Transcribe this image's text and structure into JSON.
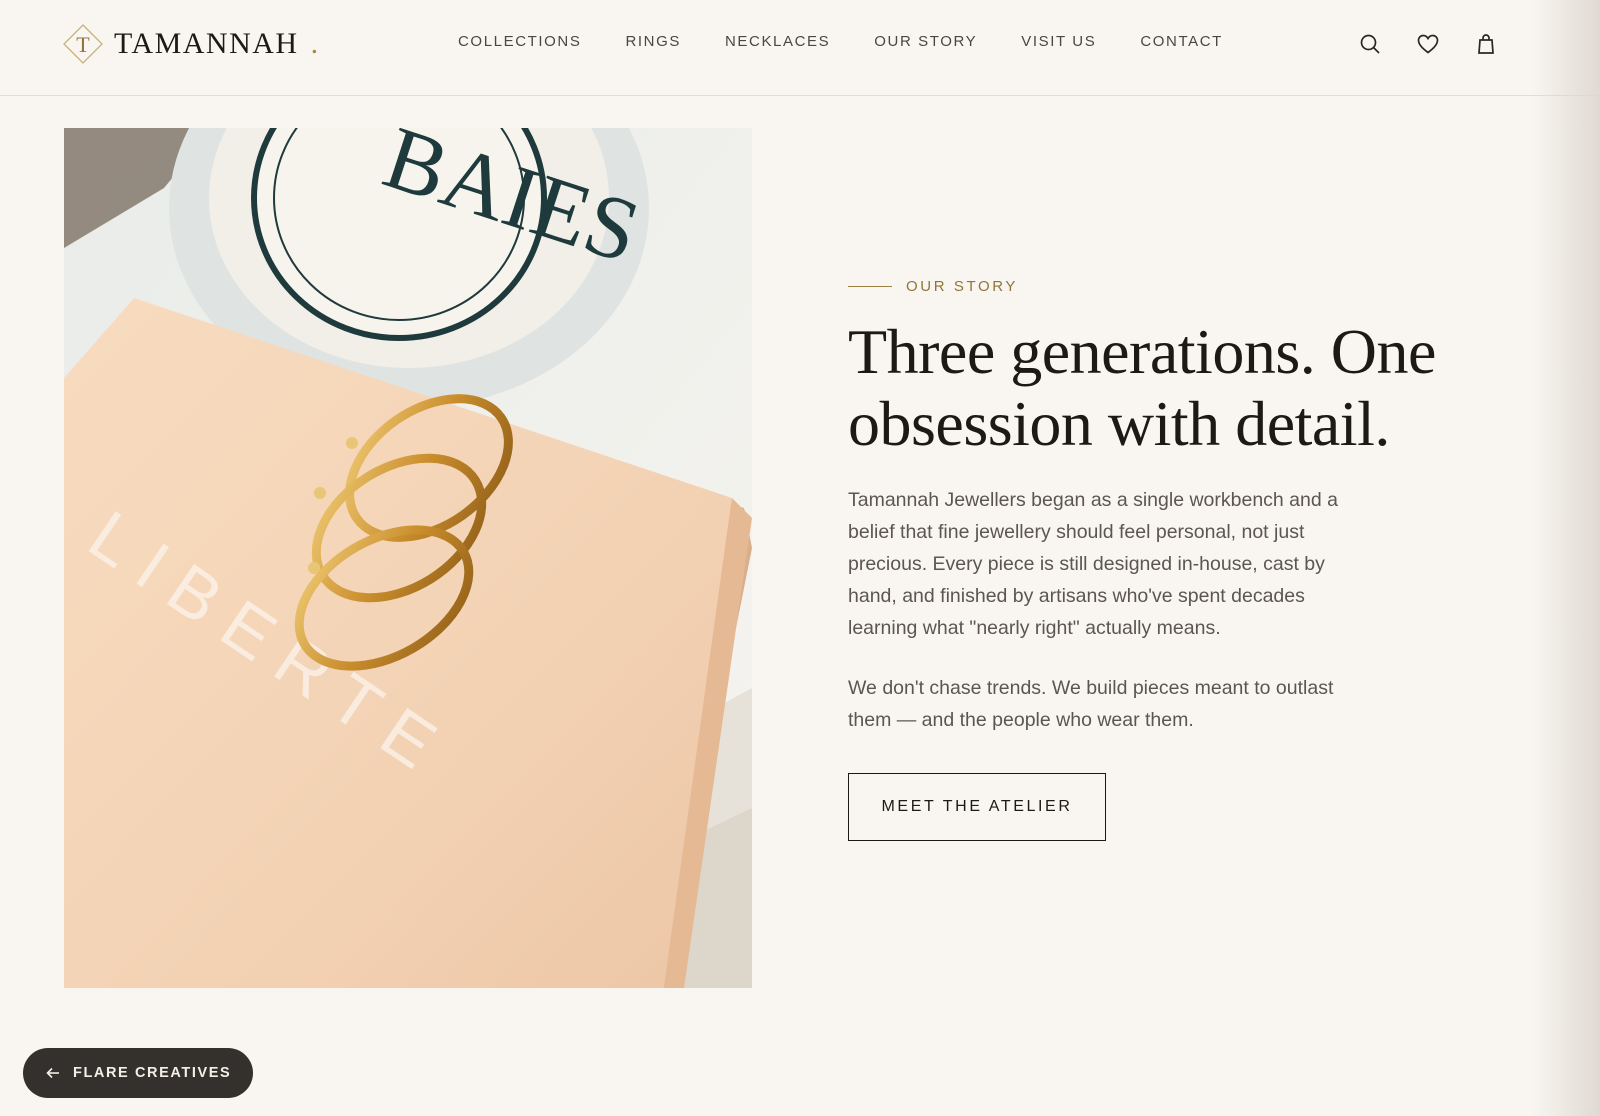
{
  "brand": {
    "initial": "T",
    "name": "TAMANNAH",
    "dot": ".",
    "accent_color": "#a88a3a"
  },
  "nav": {
    "items": [
      {
        "label": "COLLECTIONS"
      },
      {
        "label": "RINGS"
      },
      {
        "label": "NECKLACES"
      },
      {
        "label": "OUR STORY"
      },
      {
        "label": "VISIT US"
      },
      {
        "label": "CONTACT"
      }
    ]
  },
  "header_icons": [
    "search-icon",
    "heart-icon",
    "bag-icon"
  ],
  "hero": {
    "image_desc_icon": "rings-on-box-photo",
    "box_text": "LIBERTE",
    "candle_text": "BAIES"
  },
  "story": {
    "eyebrow": "OUR STORY",
    "headline_line1": "Three generations. One",
    "headline_line2": "obsession with detail.",
    "paragraph1": "Tamannah Jewellers began as a single workbench and a belief that fine jewellery should feel personal, not just precious. Every piece is still designed in-house, cast by hand, and finished by artisans who've spent decades learning what \"nearly right\" actually means.",
    "paragraph2": "We don't chase trends. We build pieces meant to outlast them — and the people who wear them.",
    "cta_label": "MEET THE ATELIER"
  },
  "badge": {
    "label": "FLARE CREATIVES",
    "icon": "arrow-left-icon"
  },
  "colors": {
    "background": "#f9f6f1",
    "text": "#1c1a17",
    "muted_text": "#5b5650",
    "gold": "#8f7637",
    "badge_bg": "#33302d"
  }
}
